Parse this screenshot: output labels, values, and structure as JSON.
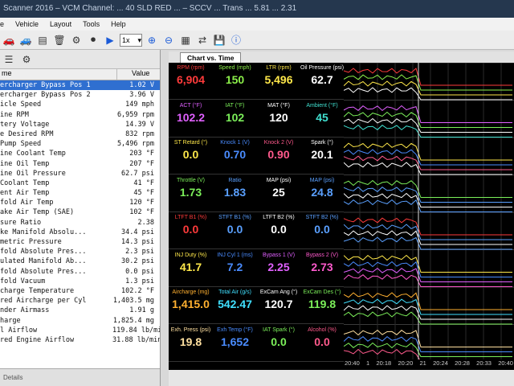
{
  "window": {
    "title": "Scanner 2016 – VCM Channel: ... 40 SLD RED ... – SCCV ... Trans ... 5.81 ... 2.31"
  },
  "menu": [
    "e",
    "Vehicle",
    "Layout",
    "Tools",
    "Help"
  ],
  "toolbar": {
    "speed_select": "1x"
  },
  "panel": {
    "header_value": "Value",
    "header_name": "me",
    "rows": [
      {
        "name": "ercharger Bypass Pos 1",
        "value": "1.02 V",
        "selected": true
      },
      {
        "name": "ercharger Bypass Pos 2",
        "value": "3.96 V"
      },
      {
        "name": "icle Speed",
        "value": "149 mph"
      },
      {
        "name": "ine RPM",
        "value": "6,959 rpm"
      },
      {
        "name": "tery Voltage",
        "value": "14.39 V"
      },
      {
        "name": "e Desired RPM",
        "value": "832 rpm"
      },
      {
        "name": " Pump Speed",
        "value": "5,496 rpm"
      },
      {
        "name": "ine Coolant Temp",
        "value": "203 °F"
      },
      {
        "name": "ine Oil Temp",
        "value": "207 °F"
      },
      {
        "name": "ine Oil Pressure",
        "value": "62.7 psi"
      },
      {
        "name": " Coolant Temp",
        "value": "41 °F"
      },
      {
        "name": "ent Air Temp",
        "value": "45 °F"
      },
      {
        "name": "fold Air Temp",
        "value": "120 °F"
      },
      {
        "name": "ake Air Temp (SAE)",
        "value": "102 °F"
      },
      {
        "name": "sure Ratio",
        "value": "2.38"
      },
      {
        "name": "ke Manifold Absolu...",
        "value": "34.4 psi"
      },
      {
        "name": "metric Pressure",
        "value": "14.3 psi"
      },
      {
        "name": "fold Absolute Pres...",
        "value": "2.3 psi"
      },
      {
        "name": "ulated Manifold Ab...",
        "value": "30.2 psi"
      },
      {
        "name": "fold Absolute Pres...",
        "value": "0.0 psi"
      },
      {
        "name": "fold Vacuum",
        "value": "1.3 psi"
      },
      {
        "name": "charge Temperature",
        "value": "102.2 °F"
      },
      {
        "name": "red Aircharge per Cyl",
        "value": "1,403.5 mg"
      },
      {
        "name": "nder Airmass",
        "value": "1.91 g"
      },
      {
        "name": "harge",
        "value": "1,825.4 mg"
      },
      {
        "name": "l Airflow",
        "value": "119.84 lb/min"
      },
      {
        "name": "red Engine Airflow",
        "value": "31.88 lb/min"
      }
    ],
    "bottom_tab": "Details"
  },
  "chart_tab": "Chart vs. Time",
  "gauge_rows": [
    [
      {
        "label": "RPM (rpm)",
        "value": "6,904",
        "color": "#ff3b3b"
      },
      {
        "label": "Speed (mph)",
        "value": "150",
        "color": "#8cf04a"
      },
      {
        "label": "LTR (rpm)",
        "value": "5,496",
        "color": "#ffe84a"
      },
      {
        "label": "Oil Pressure (psi)",
        "value": "62.7",
        "color": "#ffffff"
      }
    ],
    [
      {
        "label": "ACT (°F)",
        "value": "102.2",
        "color": "#e060ff"
      },
      {
        "label": "IAT (°F)",
        "value": "102",
        "color": "#7cf05a"
      },
      {
        "label": "MAT (°F)",
        "value": "120",
        "color": "#ffffff"
      },
      {
        "label": "Ambient (°F)",
        "value": "45",
        "color": "#40e0d0"
      }
    ],
    [
      {
        "label": "ST Retard (°)",
        "value": "0.0",
        "color": "#ffe84a"
      },
      {
        "label": "Knock 1 (V)",
        "value": "0.70",
        "color": "#4a8cff"
      },
      {
        "label": "Knock 2 (V)",
        "value": "0.90",
        "color": "#ff5a8c"
      },
      {
        "label": "Spark (°)",
        "value": "20.1",
        "color": "#ffffff"
      }
    ],
    [
      {
        "label": "Throttle (V)",
        "value": "1.73",
        "color": "#7cf05a"
      },
      {
        "label": "Ratio",
        "value": "1.83",
        "color": "#5aa0ff"
      },
      {
        "label": "MAP (psi)",
        "value": "25",
        "color": "#ffffff"
      },
      {
        "label": "MAP (psi)",
        "value": "24.8",
        "color": "#5aa0ff"
      }
    ],
    [
      {
        "label": "LTFT B1 (%)",
        "value": "0.0",
        "color": "#ff3b3b"
      },
      {
        "label": "STFT B1 (%)",
        "value": "0.0",
        "color": "#5aa0ff"
      },
      {
        "label": "LTFT B2 (%)",
        "value": "0.0",
        "color": "#ffffff"
      },
      {
        "label": "STFT B2 (%)",
        "value": "0.0",
        "color": "#5aa0ff"
      }
    ],
    [
      {
        "label": "INJ Duty (%)",
        "value": "41.7",
        "color": "#ffe84a"
      },
      {
        "label": "INJ Cyl 1 (ms)",
        "value": "7.2",
        "color": "#4a8cff"
      },
      {
        "label": "Bypass 1 (V)",
        "value": "2.25",
        "color": "#e060ff"
      },
      {
        "label": "Bypass 2 (V)",
        "value": "2.73",
        "color": "#ff5acd"
      }
    ],
    [
      {
        "label": "Aircharge (mg)",
        "value": "1,415.0",
        "color": "#ffb030"
      },
      {
        "label": "Total Air (g/s)",
        "value": "542.47",
        "color": "#40e0ff"
      },
      {
        "label": "ExCam Ang (°)",
        "value": "120.7",
        "color": "#ffffff"
      },
      {
        "label": "ExCam Des (°)",
        "value": "119.8",
        "color": "#7cf05a"
      }
    ],
    [
      {
        "label": "Exh. Press (psi)",
        "value": "19.8",
        "color": "#ffe0a0"
      },
      {
        "label": "Exh Temp (°F)",
        "value": "1,652",
        "color": "#4a8cff"
      },
      {
        "label": "IAT Spark (°)",
        "value": "0.0",
        "color": "#7cf05a"
      },
      {
        "label": "Alcohol (%)",
        "value": "0.0",
        "color": "#ff5a8c"
      }
    ]
  ],
  "time_labels": [
    "20:40",
    "1",
    "20:18",
    "20:20",
    "21",
    "20:24",
    "20:28",
    "20:33",
    "20:40"
  ]
}
